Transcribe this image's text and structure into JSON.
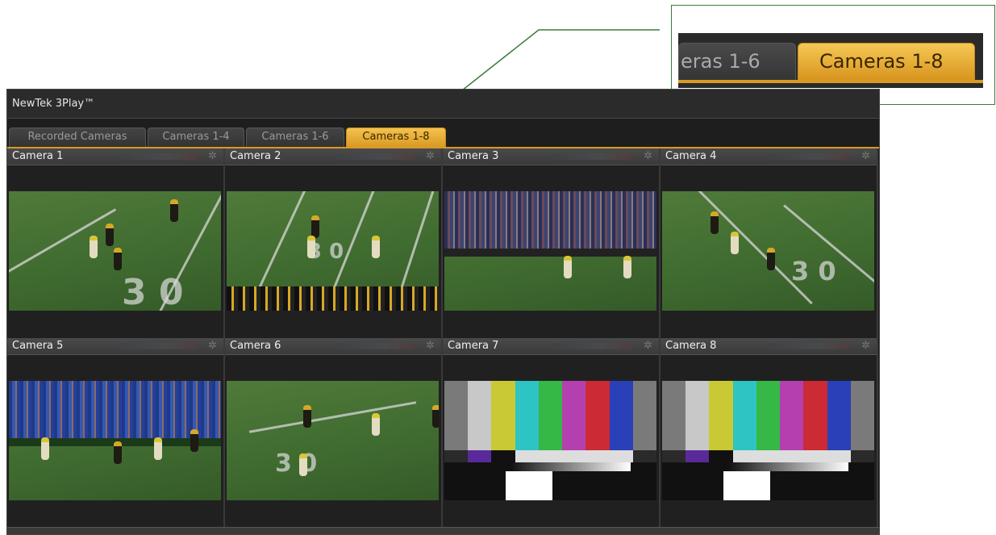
{
  "zoom_callout": {
    "tabs": [
      {
        "label": "eras 1-6",
        "active": false
      },
      {
        "label": "Cameras 1-8",
        "active": true
      }
    ]
  },
  "app": {
    "title": "NewTek 3Play™",
    "tabs": [
      {
        "label": "Recorded Cameras",
        "active": false
      },
      {
        "label": "Cameras 1-4",
        "active": false
      },
      {
        "label": "Cameras 1-6",
        "active": false
      },
      {
        "label": "Cameras 1-8",
        "active": true
      }
    ],
    "cameras": [
      {
        "name": "Camera 1",
        "feed": "football-field"
      },
      {
        "name": "Camera 2",
        "feed": "football-field"
      },
      {
        "name": "Camera 3",
        "feed": "stadium-wide"
      },
      {
        "name": "Camera 4",
        "feed": "football-field"
      },
      {
        "name": "Camera 5",
        "feed": "stadium-wide"
      },
      {
        "name": "Camera 6",
        "feed": "football-field"
      },
      {
        "name": "Camera 7",
        "feed": "color-bars"
      },
      {
        "name": "Camera 8",
        "feed": "color-bars"
      }
    ],
    "icons": {
      "settings": "gear-icon"
    },
    "colors": {
      "active_tab": "#d89a24",
      "window_bg": "#1e1e1e",
      "callout_line": "#3c7a3c"
    }
  }
}
